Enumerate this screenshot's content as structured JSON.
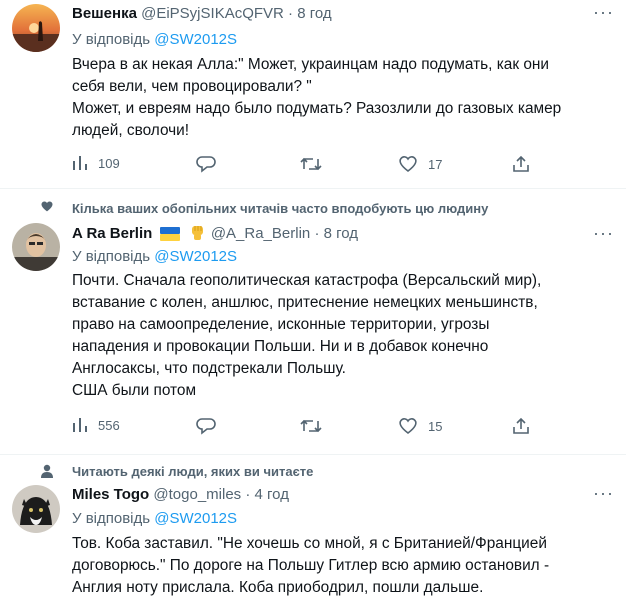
{
  "tweets": [
    {
      "display_name": "Вешенка",
      "handle": "@EiPSyjSIKAcQFVR",
      "time": "8 год",
      "reply_prefix": "У відповідь",
      "reply_to": "@SW2012S",
      "lines": [
        "Вчера в ак некая Алла:\" Может, украинцам надо подумать, как они",
        "себя вели, чем провоцировали? \"",
        "Может, и евреям надо было подумать? Разозлили до газовых камер",
        "людей, сволочи!"
      ],
      "stats": {
        "replies": "109",
        "retweets": "",
        "likes": "17"
      }
    },
    {
      "context": "Кілька ваших обопільних читачів часто вподобують цю людину",
      "display_name": "A Ra Berlin",
      "handle": "@A_Ra_Berlin",
      "time": "8 год",
      "reply_prefix": "У відповідь",
      "reply_to": "@SW2012S",
      "lines": [
        "Почти. Сначала геополитическая катастрофа (Версальский мир),",
        "вставание с колен, аншлюс,  притеснение немецких меньшинств,",
        "право на самоопределение, исконные территории, угрозы",
        "нападения и провокации Польши. Ни и в добавок конечно",
        "Англосаксы, что подстрекали Польшу.",
        "США были потом"
      ],
      "stats": {
        "replies": "556",
        "retweets": "",
        "likes": "15"
      }
    },
    {
      "context": "Читають деякі люди, яких ви читаєте",
      "display_name": "Miles Togo",
      "handle": "@togo_miles",
      "time": "4 год",
      "reply_prefix": "У відповідь",
      "reply_to": "@SW2012S",
      "lines": [
        "Тов. Коба заставил.  \"Не хочешь со мной, я с Британией/Францией",
        "договорюсь.\" По дороге на Польшу Гитлер всю армию остановил -",
        "Англия ноту прислала. Коба приободрил, пошли дальше."
      ]
    }
  ],
  "icons": {
    "analytics": "analytics-icon",
    "reply": "reply-icon",
    "retweet": "retweet-icon",
    "like": "like-icon",
    "share": "share-icon",
    "more": "more-icon",
    "heart-context": "heart-context-icon",
    "person-context": "person-context-icon"
  },
  "colors": {
    "link": "#1d9bf0",
    "muted": "#536471",
    "text": "#0f1419"
  }
}
